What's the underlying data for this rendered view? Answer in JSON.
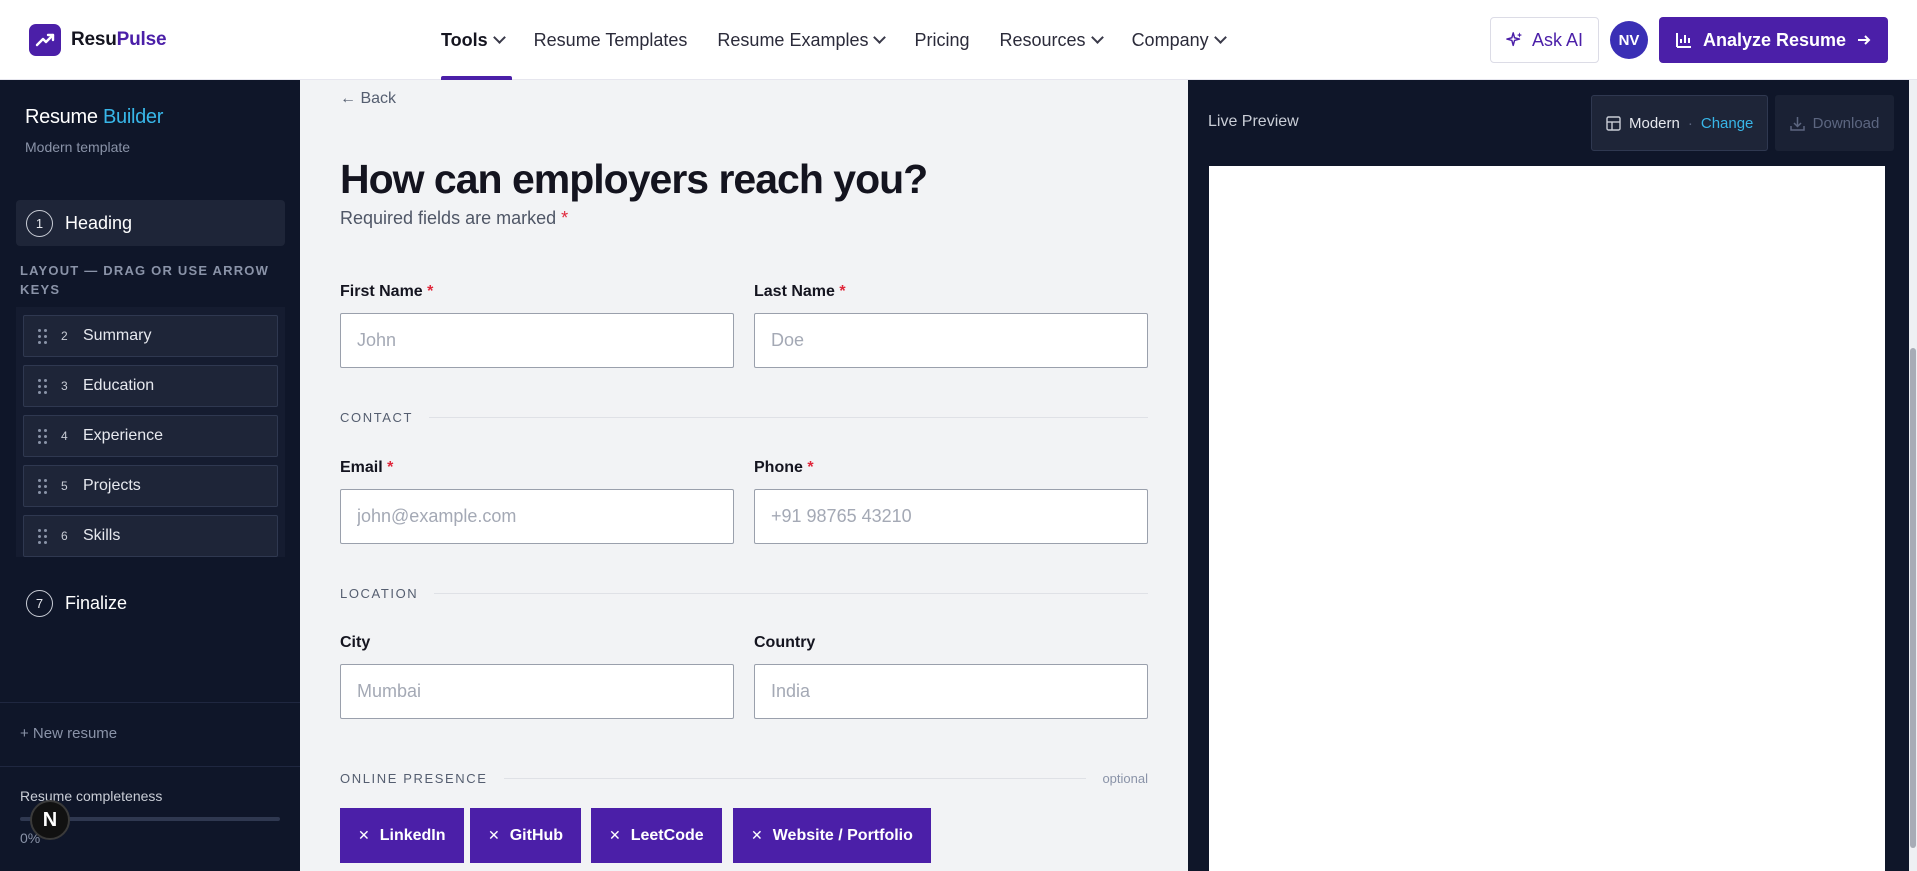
{
  "brand": {
    "name_part1": "Resu",
    "name_part2": "Pulse",
    "colors": {
      "primary": "#4b1fa8",
      "accent": "#38b6e8",
      "dark": "#0f1629",
      "required": "#e0263a"
    }
  },
  "nav": {
    "items": [
      {
        "label": "Tools",
        "dropdown": true,
        "active": true
      },
      {
        "label": "Resume Templates",
        "dropdown": false
      },
      {
        "label": "Resume Examples",
        "dropdown": true
      },
      {
        "label": "Pricing",
        "dropdown": false
      },
      {
        "label": "Resources",
        "dropdown": true
      },
      {
        "label": "Company",
        "dropdown": true
      }
    ],
    "ask_ai": "Ask AI",
    "avatar_initials": "NV",
    "analyze_button": "Analyze Resume"
  },
  "sidebar": {
    "title_part1": "Resume",
    "title_part2": "Builder",
    "subtitle": "Modern template",
    "active_step": {
      "number": "1",
      "label": "Heading"
    },
    "layout_header": "Layout — drag or use arrow keys",
    "layout_items": [
      {
        "number": "2",
        "label": "Summary"
      },
      {
        "number": "3",
        "label": "Education"
      },
      {
        "number": "4",
        "label": "Experience"
      },
      {
        "number": "5",
        "label": "Projects"
      },
      {
        "number": "6",
        "label": "Skills"
      }
    ],
    "final_step": {
      "number": "7",
      "label": "Finalize"
    },
    "new_resume": "+ New resume",
    "completeness_label": "Resume completeness",
    "completeness_value": "0%",
    "completeness_fraction": 0,
    "floating_badge": "N"
  },
  "form": {
    "back": "← Back",
    "heading": "How can employers reach you?",
    "required_note": "Required fields are marked",
    "required_star": "*",
    "fields": {
      "first_name": {
        "label": "First Name",
        "required": true,
        "placeholder": "John",
        "value": ""
      },
      "last_name": {
        "label": "Last Name",
        "required": true,
        "placeholder": "Doe",
        "value": ""
      },
      "email": {
        "label": "Email",
        "required": true,
        "placeholder": "john@example.com",
        "value": ""
      },
      "phone": {
        "label": "Phone",
        "required": true,
        "placeholder": "+91 98765 43210",
        "value": ""
      },
      "city": {
        "label": "City",
        "required": false,
        "placeholder": "Mumbai",
        "value": ""
      },
      "country": {
        "label": "Country",
        "required": false,
        "placeholder": "India",
        "value": ""
      }
    },
    "sections": {
      "contact": "CONTACT",
      "location": "LOCATION",
      "online_presence": "ONLINE PRESENCE",
      "optional": "optional"
    },
    "chips": [
      "LinkedIn",
      "GitHub",
      "LeetCode",
      "Website / Portfolio"
    ]
  },
  "preview": {
    "label": "Live Preview",
    "template_name": "Modern",
    "separator": "·",
    "change": "Change",
    "download": "Download"
  }
}
